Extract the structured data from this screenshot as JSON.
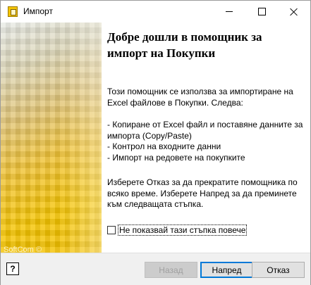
{
  "window": {
    "title": "Импорт",
    "icon": "import-wizard-icon"
  },
  "banner": {
    "caption": "SoftCom ©"
  },
  "content": {
    "heading_line1": "Добре дошли в помощник за",
    "heading_line2": "импорт на Покупки",
    "intro_line1": "Този помощник се използва за импортиране на",
    "intro_line2": "Excel файлове в Покупки.  Следва:",
    "steps": [
      "- Копиране от Excel файл и поставяне данните за",
      "импорта (Copy/Paste)",
      "- Контрол на входните данни",
      "- Импорт на редовете на покупките"
    ],
    "cancel_line1": "Изберете Отказ за да прекратите помощника по",
    "cancel_line2": "всяко време.  Изберете Напред за да преминете",
    "cancel_line3": "към следващата стъпка.",
    "checkbox_label": "Не показвай тази стъпка повече",
    "checkbox_checked": false
  },
  "footer": {
    "help_label": "?",
    "back_label": "Назад",
    "next_label": "Напред",
    "cancel_label": "Отказ"
  },
  "colors": {
    "accent": "#0078d7",
    "banner": "#f5c400"
  }
}
